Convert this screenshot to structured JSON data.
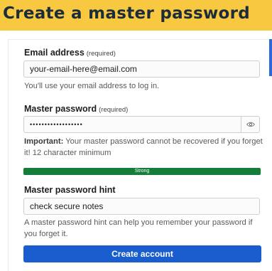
{
  "banner": {
    "title": "Create a master password",
    "color": "#f8c940"
  },
  "email": {
    "label": "Email address",
    "required": "(required)",
    "value": "your-email-here@email.com",
    "help": "You'll use your email address to log in."
  },
  "master_password": {
    "label": "Master password",
    "required": "(required)",
    "value": "••••••••••••••••••",
    "toggle_icon": "eye-icon",
    "help_strong": "Important:",
    "help": " Your master password cannot be recovered if you forget it! 12 character minimum"
  },
  "strength": {
    "label": "Strong",
    "level": 1.0,
    "color": "#157d3a"
  },
  "hint": {
    "label": "Master password hint",
    "value": "check secure notes",
    "help": "A master password hint can help you remember your password if you forget it."
  },
  "submit": {
    "label": "Create account",
    "color": "#1a5dcf"
  }
}
